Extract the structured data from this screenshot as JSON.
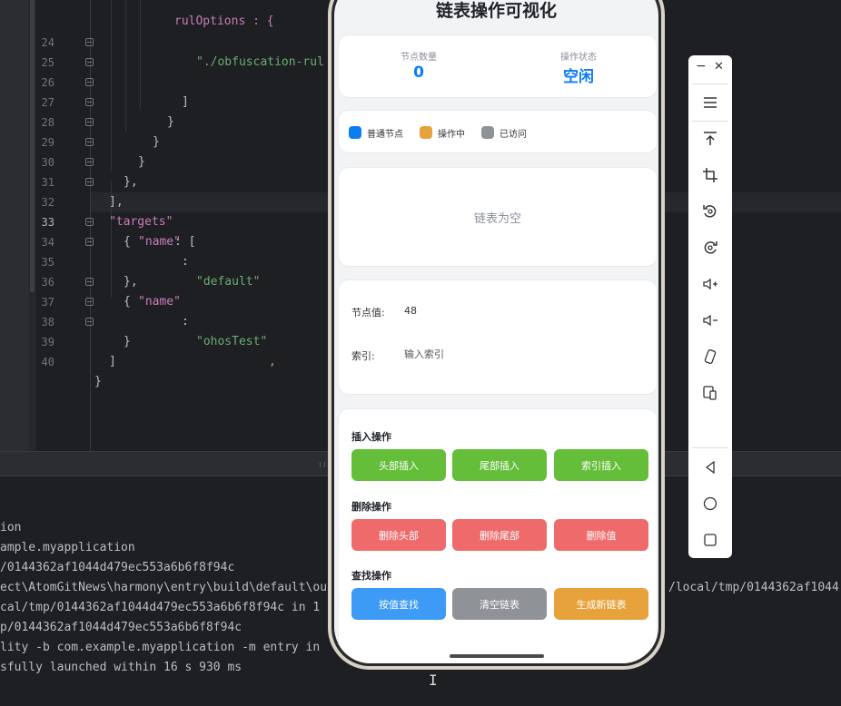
{
  "editor": {
    "lines": [
      {
        "num": "24",
        "text": "\"./obfuscation-rul"
      },
      {
        "num": "25",
        "text": "]"
      },
      {
        "num": "26",
        "text": "}"
      },
      {
        "num": "27",
        "text": "}"
      },
      {
        "num": "28",
        "text": "}"
      },
      {
        "num": "29",
        "text": "},"
      },
      {
        "num": "30",
        "text": "],"
      },
      {
        "num": "31",
        "key": "\"targets\"",
        "rest": ": ["
      },
      {
        "num": "32",
        "text": "{"
      },
      {
        "num": "33",
        "key": "\"name\"",
        "rest": ": ",
        "value": "\"default\""
      },
      {
        "num": "34",
        "text": "},"
      },
      {
        "num": "35",
        "text": "{"
      },
      {
        "num": "36",
        "key": "\"name\"",
        "rest": ": ",
        "value": "\"ohosTest\"",
        "trail": ","
      },
      {
        "num": "37",
        "text": "}"
      },
      {
        "num": "38",
        "text": "]"
      },
      {
        "num": "39",
        "text": "}"
      },
      {
        "num": "40",
        "text": ""
      }
    ],
    "top_partial": "rulOptions : {"
  },
  "terminal": {
    "lines": [
      "ion",
      "ample.myapplication",
      "/0144362af1044d479ec553a6b6f8f94c",
      "ect\\AtomGitNews\\harmony\\entry\\build\\default\\ou",
      "cal/tmp/0144362af1044d479ec553a6b6f8f94c in 1",
      "p/0144362af1044d479ec553a6b6f8f94c",
      "lity -b com.example.myapplication -m entry in",
      "sfully launched within 16 s 930 ms"
    ],
    "right_text": "/local/tmp/0144362af1044"
  },
  "app": {
    "title": "链表操作可视化",
    "stats": {
      "node_count_label": "节点数量",
      "node_count_value": "0",
      "status_label": "操作状态",
      "status_value": "空闲"
    },
    "legend": [
      {
        "label": "普通节点",
        "color": "#0a7df2"
      },
      {
        "label": "操作中",
        "color": "#e7a23c"
      },
      {
        "label": "已访问",
        "color": "#8f9297"
      }
    ],
    "empty_text": "链表为空",
    "inputs": {
      "value_label": "节点值:",
      "value_value": "48",
      "index_label": "索引:",
      "index_placeholder": "输入索引"
    },
    "operations": {
      "insert_title": "插入操作",
      "insert_head": "头部插入",
      "insert_tail": "尾部插入",
      "insert_index": "索引插入",
      "delete_title": "删除操作",
      "delete_head": "删除头部",
      "delete_tail": "删除尾部",
      "delete_value": "删除值",
      "find_title": "查找操作",
      "find_by_value": "按值查找",
      "clear_list": "清空链表",
      "generate_list": "生成新链表"
    }
  },
  "toolbar": {
    "minimize": "−",
    "close": "✕",
    "icons": [
      "menu-icon",
      "pin-top-icon",
      "crop-icon",
      "rotate-left-icon",
      "rotate-right-icon",
      "volume-up-icon",
      "volume-down-icon",
      "shake-icon",
      "multi-device-icon",
      "back-icon",
      "home-icon",
      "recents-icon"
    ]
  }
}
